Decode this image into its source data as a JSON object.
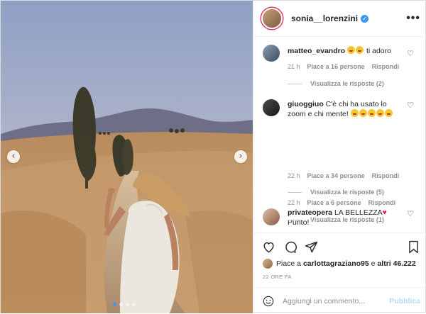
{
  "post": {
    "username": "sonia__lorenzini",
    "verified_icon": "verified-badge-icon",
    "more_label": "•••"
  },
  "carousel": {
    "prev_icon": "‹",
    "next_icon": "›",
    "dots": 4,
    "active_index": 0
  },
  "comments": [
    {
      "user": "matteo_evandro",
      "text": " ti adoro",
      "emoji_count": 2,
      "time": "21 h",
      "likes": "Piace a 16 persone",
      "reply": "Rispondi",
      "view_replies": "Visualizza le risposte (2)"
    },
    {
      "user": "giuoggiuo",
      "text": "C'è chi ha usato lo zoom e chi mente!",
      "emoji_count": 5,
      "time": "22 h",
      "likes": "Piace a 34 persone",
      "reply": "Rispondi",
      "view_replies": "Visualizza le risposte (5)"
    },
    {
      "user": "privateopera",
      "text": "LA BELLEZZA",
      "text2": "Punto!",
      "time": "22 h",
      "likes": "Piace a 6 persone",
      "reply": "Rispondi",
      "view_replies": "Visualizza le risposte (1)"
    }
  ],
  "likes": {
    "prefix": "Piace a",
    "user": "carlottagraziano95",
    "middle": "e",
    "others": "altri 46.222"
  },
  "timestamp": "22 ORE FA",
  "composer": {
    "placeholder": "Aggiungi un commento...",
    "publish_label": "Pubblica"
  },
  "colors": {
    "accent": "#3897f0",
    "heart": "#e0245e",
    "publish_disabled": "#b3dbff"
  }
}
